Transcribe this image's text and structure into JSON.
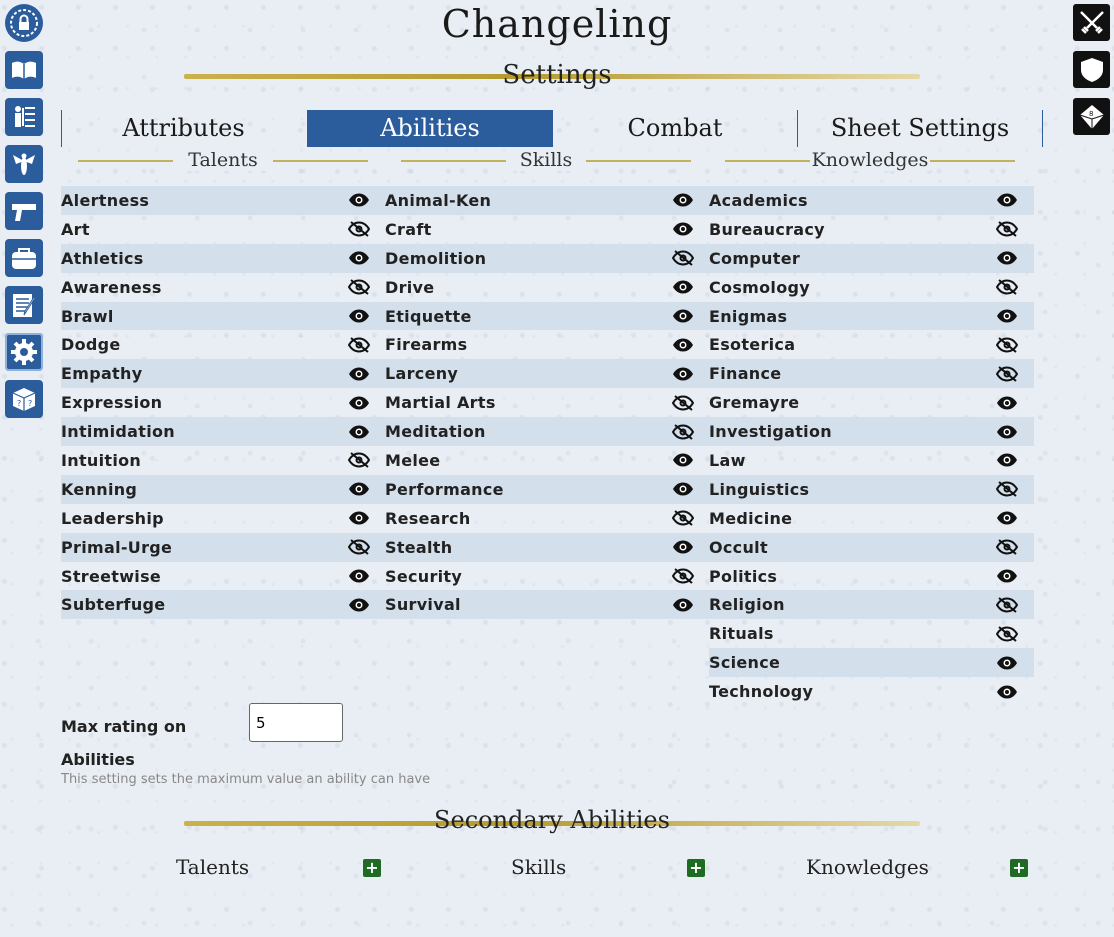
{
  "app_title": "Changeling",
  "settings_heading": "Settings",
  "tabs": [
    {
      "label": "Attributes",
      "active": false
    },
    {
      "label": "Abilities",
      "active": true
    },
    {
      "label": "Combat",
      "active": false
    },
    {
      "label": "Sheet Settings",
      "active": false
    }
  ],
  "columns": [
    {
      "heading": "Talents",
      "items": [
        {
          "label": "Alertness",
          "visible": true
        },
        {
          "label": "Art",
          "visible": false
        },
        {
          "label": "Athletics",
          "visible": true
        },
        {
          "label": "Awareness",
          "visible": false
        },
        {
          "label": "Brawl",
          "visible": true
        },
        {
          "label": "Dodge",
          "visible": false
        },
        {
          "label": "Empathy",
          "visible": true
        },
        {
          "label": "Expression",
          "visible": true
        },
        {
          "label": "Intimidation",
          "visible": true
        },
        {
          "label": "Intuition",
          "visible": false
        },
        {
          "label": "Kenning",
          "visible": true
        },
        {
          "label": "Leadership",
          "visible": true
        },
        {
          "label": "Primal-Urge",
          "visible": false
        },
        {
          "label": "Streetwise",
          "visible": true
        },
        {
          "label": "Subterfuge",
          "visible": true
        }
      ]
    },
    {
      "heading": "Skills",
      "items": [
        {
          "label": "Animal-Ken",
          "visible": true
        },
        {
          "label": "Craft",
          "visible": true
        },
        {
          "label": "Demolition",
          "visible": false
        },
        {
          "label": "Drive",
          "visible": true
        },
        {
          "label": "Etiquette",
          "visible": true
        },
        {
          "label": "Firearms",
          "visible": true
        },
        {
          "label": "Larceny",
          "visible": true
        },
        {
          "label": "Martial Arts",
          "visible": false
        },
        {
          "label": "Meditation",
          "visible": false
        },
        {
          "label": "Melee",
          "visible": true
        },
        {
          "label": "Performance",
          "visible": true
        },
        {
          "label": "Research",
          "visible": false
        },
        {
          "label": "Stealth",
          "visible": true
        },
        {
          "label": "Security",
          "visible": false
        },
        {
          "label": "Survival",
          "visible": true
        }
      ]
    },
    {
      "heading": "Knowledges",
      "items": [
        {
          "label": "Academics",
          "visible": true
        },
        {
          "label": "Bureaucracy",
          "visible": false
        },
        {
          "label": "Computer",
          "visible": true
        },
        {
          "label": "Cosmology",
          "visible": false
        },
        {
          "label": "Enigmas",
          "visible": true
        },
        {
          "label": "Esoterica",
          "visible": false
        },
        {
          "label": "Finance",
          "visible": false
        },
        {
          "label": "Gremayre",
          "visible": true
        },
        {
          "label": "Investigation",
          "visible": true
        },
        {
          "label": "Law",
          "visible": true
        },
        {
          "label": "Linguistics",
          "visible": false
        },
        {
          "label": "Medicine",
          "visible": true
        },
        {
          "label": "Occult",
          "visible": false
        },
        {
          "label": "Politics",
          "visible": true
        },
        {
          "label": "Religion",
          "visible": false
        },
        {
          "label": "Rituals",
          "visible": false
        },
        {
          "label": "Science",
          "visible": true
        },
        {
          "label": "Technology",
          "visible": true
        }
      ]
    }
  ],
  "max_rating": {
    "label": "Max rating on Abilities",
    "value": "5",
    "hint": "This setting sets the maximum value an ability can have"
  },
  "secondary": {
    "heading": "Secondary Abilities",
    "items": [
      "Talents",
      "Skills",
      "Knowledges"
    ],
    "add_symbol": "+"
  },
  "left_icons": [
    "lock-icon",
    "book-icon",
    "tree-icon",
    "wasp-icon",
    "pistol-icon",
    "bag-icon",
    "notes-icon",
    "gear-icon",
    "dice-question-icon"
  ],
  "right_icons": [
    "crossed-swords-icon",
    "shield-icon",
    "d10-dice-icon"
  ],
  "colors": {
    "accent": "#2b5c9c",
    "row_shade": "#d4dfec",
    "add_button": "#1e6b23",
    "gold": "#b69b2d"
  }
}
